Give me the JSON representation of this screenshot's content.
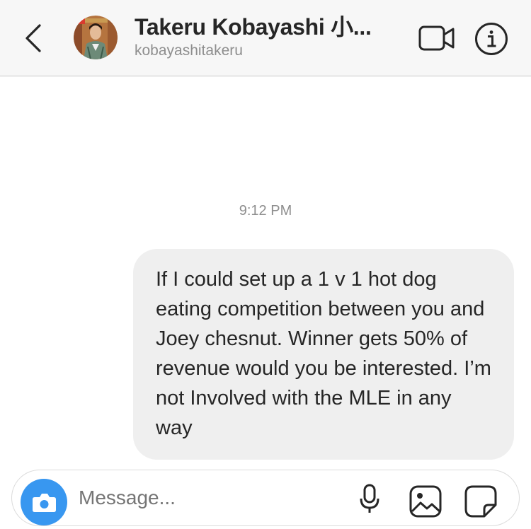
{
  "header": {
    "contact_name": "Takeru Kobayashi 小...",
    "username": "kobayashitakeru"
  },
  "icons": {
    "back": "chevron-left-icon",
    "video": "video-camera-icon",
    "info": "info-icon",
    "camera": "camera-icon",
    "mic": "microphone-icon",
    "gallery": "photo-gallery-icon",
    "sticker": "sticker-icon"
  },
  "conversation": {
    "timestamp": "9:12 PM",
    "messages": [
      {
        "sender": "me",
        "text": "If I could set up a 1 v 1 hot dog eating competition between you and Joey chesnut. Winner gets 50% of revenue would you be interested. I’m not Involved with the MLE in any way"
      }
    ]
  },
  "composer": {
    "placeholder": "Message..."
  },
  "colors": {
    "header_bg": "#f7f7f7",
    "bubble_bg": "#efefef",
    "text": "#262626",
    "secondary_text": "#8e8e8e",
    "camera_button": "#3897f0"
  }
}
